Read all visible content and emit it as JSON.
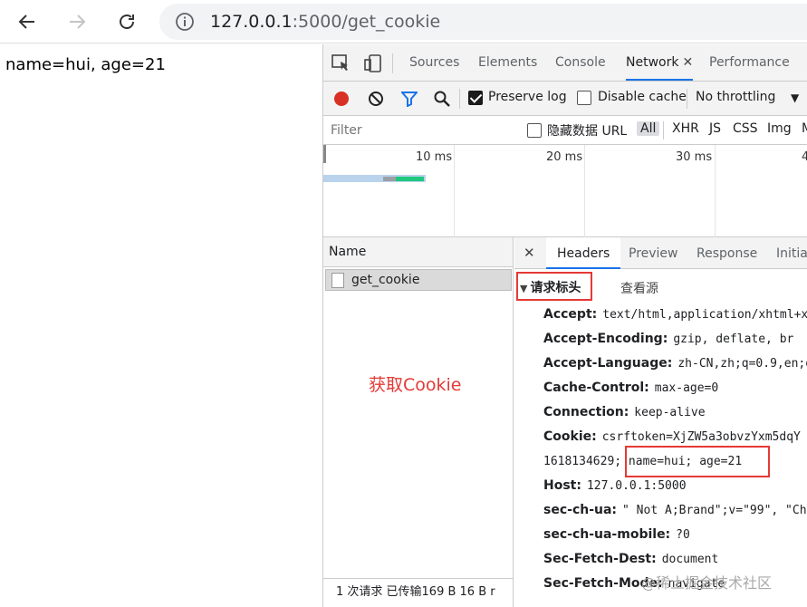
{
  "browser": {
    "url_host": "127.0.0.1",
    "url_path": ":5000/get_cookie"
  },
  "page": {
    "content": "name=hui, age=21"
  },
  "devtools": {
    "tabs": [
      {
        "label": "Sources"
      },
      {
        "label": "Elements"
      },
      {
        "label": "Console"
      },
      {
        "label": "Network",
        "active": true
      },
      {
        "label": "Performance"
      }
    ],
    "toolbar": {
      "preserve_log_label": "Preserve log",
      "preserve_log_checked": true,
      "disable_cache_label": "Disable cache",
      "disable_cache_checked": false,
      "throttling_value": "No throttling"
    },
    "filter": {
      "placeholder": "Filter",
      "hide_data_urls_label": "隐藏数据 URL",
      "types": [
        "All",
        "XHR",
        "JS",
        "CSS",
        "Img",
        "M"
      ]
    },
    "overview": {
      "ticks": [
        "10 ms",
        "20 ms",
        "30 ms",
        "4"
      ]
    },
    "requests": {
      "column_header": "Name",
      "items": [
        {
          "name": "get_cookie"
        }
      ],
      "annotation": "获取Cookie",
      "status_summary": "1 次请求  已传输169 B  16 B r"
    },
    "detail": {
      "tabs": [
        "Headers",
        "Preview",
        "Response",
        "Initiat"
      ],
      "active_tab": "Headers",
      "section_title": "请求标头",
      "view_source": "查看源",
      "headers": [
        {
          "key": "Accept:",
          "value": "text/html,application/xhtml+x"
        },
        {
          "key": "Accept-Encoding:",
          "value": "gzip, deflate, br"
        },
        {
          "key": "Accept-Language:",
          "value": "zh-CN,zh;q=0.9,en;q="
        },
        {
          "key": "Cache-Control:",
          "value": "max-age=0"
        },
        {
          "key": "Connection:",
          "value": "keep-alive"
        },
        {
          "key": "Cookie:",
          "value": "csrftoken=XjZW5a3obvzYxm5dqY"
        },
        {
          "key": "Host:",
          "value": "127.0.0.1:5000"
        },
        {
          "key": "sec-ch-ua:",
          "value": "\" Not A;Brand\";v=\"99\", \"Ch"
        },
        {
          "key": "sec-ch-ua-mobile:",
          "value": "?0"
        },
        {
          "key": "Sec-Fetch-Dest:",
          "value": "document"
        },
        {
          "key": "Sec-Fetch-Mode:",
          "value": "navigate"
        }
      ],
      "cookie_continuation_prefix": "1618134629;",
      "cookie_highlight": "name=hui; age=21"
    }
  },
  "watermark": "@稀土掘金技术社区"
}
